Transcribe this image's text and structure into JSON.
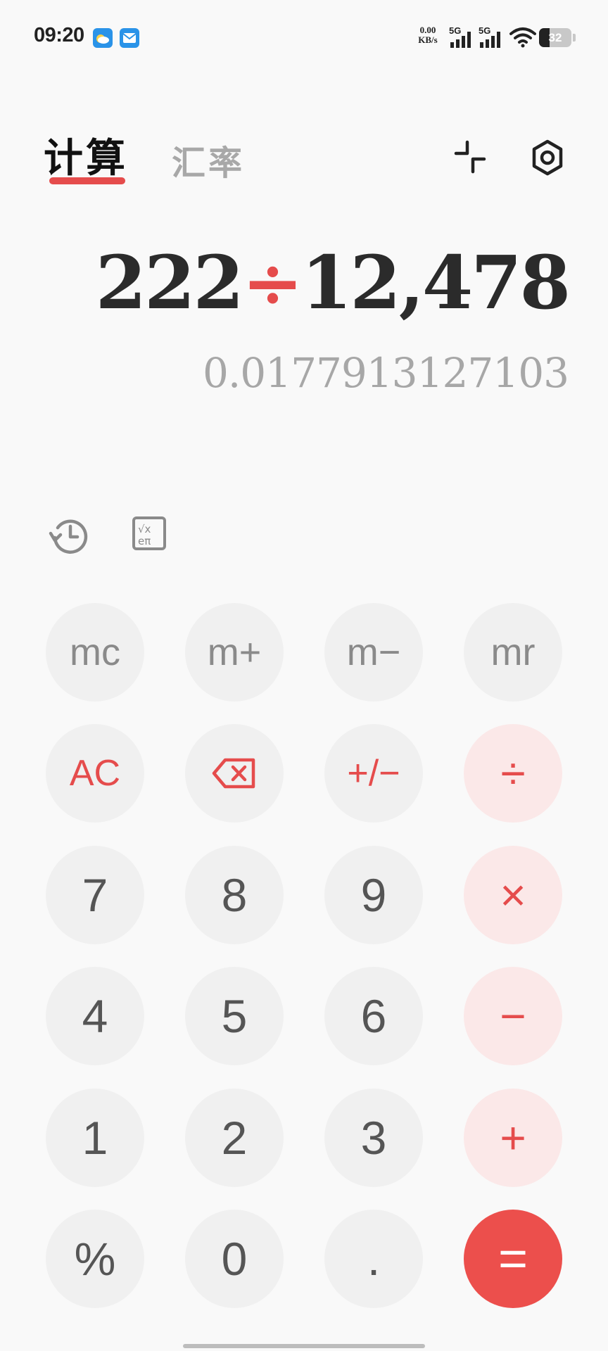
{
  "status_bar": {
    "time": "09:20",
    "net_speed_value": "0.00",
    "net_speed_unit": "KB/s",
    "signal1_label": "5G",
    "signal2_label": "5G",
    "battery_level": "32",
    "icons": [
      "weather-app-icon",
      "mail-app-icon",
      "signal-icon",
      "wifi-icon",
      "battery-icon"
    ]
  },
  "header": {
    "tab_calculator": "计算",
    "tab_exchange_rate": "汇率",
    "active_tab": "计算",
    "accent_color": "#e54c4c",
    "icons": [
      "collapse-icon",
      "settings-icon"
    ]
  },
  "display": {
    "operand1": "222",
    "operator": "÷",
    "operand2": "12,478",
    "result": "0.0177913127103"
  },
  "tools": {
    "icons": [
      "history-icon",
      "scientific-icon"
    ]
  },
  "keypad": {
    "mc": "mc",
    "m_plus": "m+",
    "m_minus": "m−",
    "mr": "mr",
    "ac": "AC",
    "plus_minus": "+/−",
    "divide": "÷",
    "seven": "7",
    "eight": "8",
    "nine": "9",
    "multiply": "×",
    "four": "4",
    "five": "5",
    "six": "6",
    "minus": "−",
    "one": "1",
    "two": "2",
    "three": "3",
    "plus": "+",
    "percent": "%",
    "zero": "0",
    "decimal": ".",
    "equals": "="
  }
}
